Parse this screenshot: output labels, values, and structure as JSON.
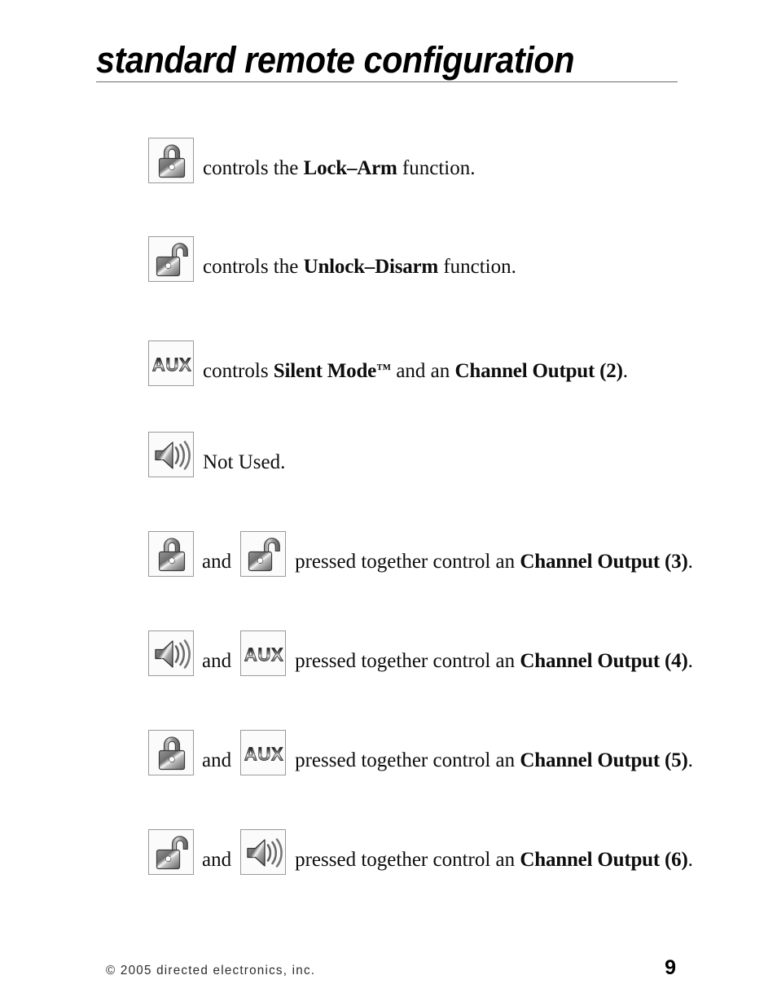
{
  "document": {
    "title": "standard remote configuration",
    "page_number": "9",
    "copyright": "© 2005 directed electronics, inc."
  },
  "icons": {
    "lock": "lock-closed-icon",
    "unlock": "lock-open-icon",
    "aux": "aux-button-icon",
    "speaker": "speaker-icon",
    "aux_label": "AUX"
  },
  "rows": [
    {
      "id": "lock-arm",
      "icons": [
        "lock"
      ],
      "lead": "controls the ",
      "bold1": "Lock–Arm",
      "mid": " function.",
      "bold2": "",
      "tail": ""
    },
    {
      "id": "unlock-disarm",
      "icons": [
        "unlock"
      ],
      "lead": "controls the ",
      "bold1": "Unlock–Disarm",
      "mid": " function.",
      "bold2": "",
      "tail": ""
    },
    {
      "id": "silent-mode",
      "icons": [
        "aux"
      ],
      "lead": "controls ",
      "bold1": "Silent Mode",
      "trademark": "™",
      "mid": " and an ",
      "bold2": "Channel Output (2)",
      "tail": "."
    },
    {
      "id": "not-used",
      "icons": [
        "speaker"
      ],
      "lead": "Not Used.",
      "bold1": "",
      "mid": "",
      "bold2": "",
      "tail": ""
    },
    {
      "id": "channel-output-3",
      "icons": [
        "lock",
        "unlock"
      ],
      "joiner": "and",
      "lead": "pressed together control an ",
      "bold2": "Channel Output (3)",
      "tail": "."
    },
    {
      "id": "channel-output-4",
      "icons": [
        "speaker",
        "aux"
      ],
      "joiner": "and",
      "lead": "pressed together control an ",
      "bold2": "Channel Output (4)",
      "tail": "."
    },
    {
      "id": "channel-output-5",
      "icons": [
        "lock",
        "aux"
      ],
      "joiner": "and",
      "lead": "pressed together control an ",
      "bold2": "Channel Output (5)",
      "tail": "."
    },
    {
      "id": "channel-output-6",
      "icons": [
        "unlock",
        "speaker"
      ],
      "joiner": "and",
      "lead": "pressed together control an ",
      "bold2": "Channel Output (6)",
      "tail": "."
    }
  ],
  "colors": {
    "text": "#0d0d0d",
    "rule": "#6d6d6d",
    "icon_border": "#9a9a9a",
    "icon_bg": "#fbfbfb",
    "metal_dark": "#5c5c5c",
    "metal_light": "#e8e8e8"
  }
}
